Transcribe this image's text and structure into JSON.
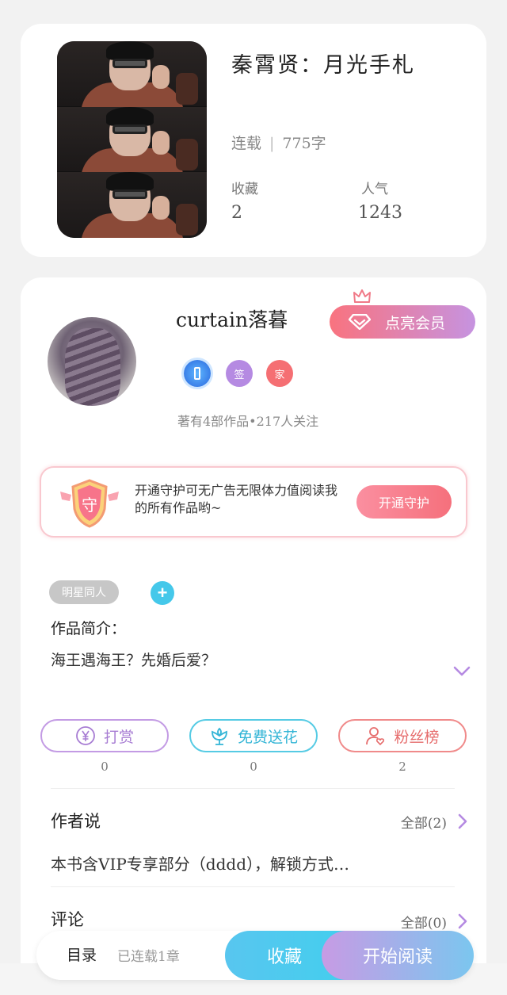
{
  "book": {
    "title": "秦霄贤：月光手札",
    "status": "连载",
    "word_count": "775字",
    "favorites_label": "收藏",
    "favorites_value": "2",
    "popularity_label": "人气",
    "popularity_value": "1243"
  },
  "author": {
    "name": "curtain落暮",
    "vip_button": "点亮会员",
    "badges": [
      "",
      "签",
      "家"
    ],
    "stats": "著有4部作品•217人关注"
  },
  "guard": {
    "text": "开通守护可无广告无限体力值阅读我的所有作品哟~",
    "button": "开通守护",
    "shield_char": "守"
  },
  "tags": [
    "明星同人"
  ],
  "add_tag": "+",
  "intro": {
    "label": "作品简介：",
    "text": "海王遇海王？先婚后爱？"
  },
  "actions": [
    {
      "label": "打赏",
      "count": "0",
      "icon": "yen-coin-icon",
      "color": "#a77cd3"
    },
    {
      "label": "免费送花",
      "count": "0",
      "icon": "flower-icon",
      "color": "#33b5d6"
    },
    {
      "label": "粉丝榜",
      "count": "2",
      "icon": "user-heart-icon",
      "color": "#e66c6c"
    }
  ],
  "author_says": {
    "title": "作者说",
    "more": "全部(2)",
    "content": "本书含VIP专享部分（dddd），解锁方式…"
  },
  "comments": {
    "title": "评论",
    "more": "全部(0)"
  },
  "bottom_bar": {
    "toc": "目录",
    "serial_status": "已连载1章",
    "collect": "收藏",
    "read": "开始阅读"
  }
}
